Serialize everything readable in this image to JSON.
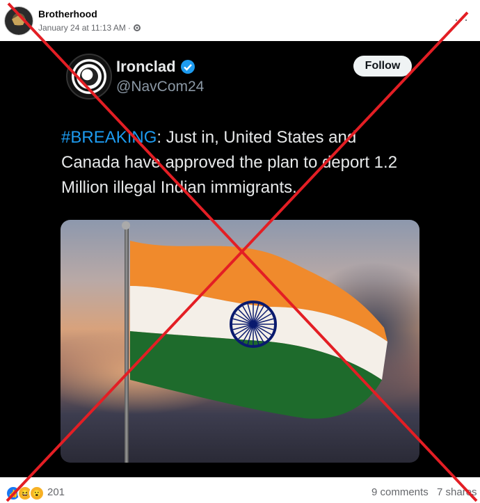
{
  "post": {
    "page_name": "Brotherhood",
    "timestamp": "January 24 at 11:13 AM",
    "meta_separator": "·",
    "more_label": "···"
  },
  "tweet": {
    "display_name": "Ironclad",
    "handle": "@NavCom24",
    "follow_label": "Follow",
    "hashtag": "#BREAKING",
    "body": ": Just in, United States and Canada have approved the plan to deport 1.2 Million illegal Indian immigrants."
  },
  "footer": {
    "reaction_count": "201",
    "comments": "9 comments",
    "shares": "7 shares"
  },
  "colors": {
    "cross": "#e31e24",
    "hashtag": "#1d9bf0",
    "saffron": "#f08a2c",
    "green": "#1e6b2c",
    "chakra": "#0a1a6e"
  },
  "icons": [
    "gear-icon",
    "verified-icon",
    "like-icon",
    "haha-icon",
    "wow-icon",
    "more-icon"
  ]
}
